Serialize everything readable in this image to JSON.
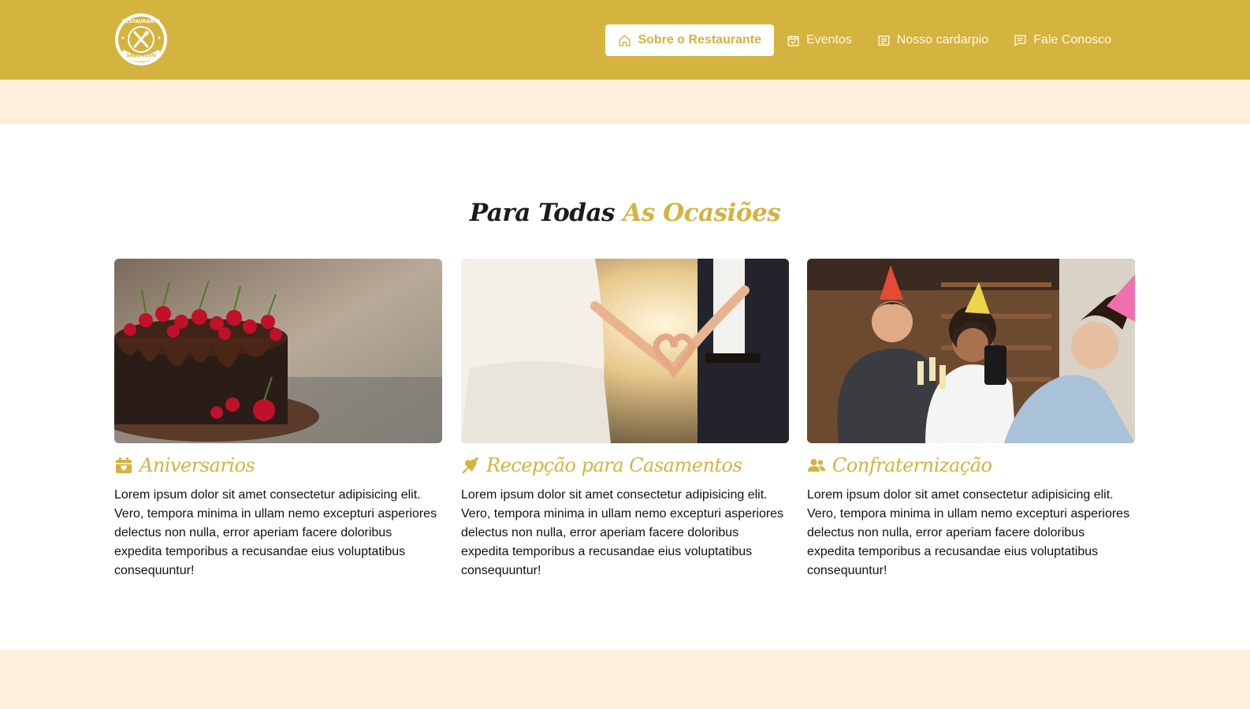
{
  "brand": {
    "logo_text_top": "RESTAURANTE",
    "logo_text_bottom": "SABOROSO"
  },
  "nav": {
    "items": [
      {
        "label": "Sobre o Restaurante",
        "icon": "home-icon"
      },
      {
        "label": "Eventos",
        "icon": "calendar-check-icon"
      },
      {
        "label": "Nosso cardarpio",
        "icon": "menu-list-icon"
      },
      {
        "label": "Fale Conosco",
        "icon": "message-icon"
      }
    ],
    "active_index": 0
  },
  "section": {
    "title_part1": "Para Todas",
    "title_part2": "As Ocasiões"
  },
  "cards": [
    {
      "title": "Aniversarios",
      "icon": "calendar-heart-icon",
      "image": "chocolate cake with cherries",
      "text": "Lorem ipsum dolor sit amet consectetur adipisicing elit. Vero, tempora minima in ullam nemo excepturi asperiores delectus non nulla, error aperiam facere doloribus expedita temporibus a recusandae eius voluptatibus consequuntur!"
    },
    {
      "title": "Recepção para Casamentos",
      "icon": "heart-arrow-icon",
      "image": "bride and groom forming heart with hands",
      "text": "Lorem ipsum dolor sit amet consectetur adipisicing elit. Vero, tempora minima in ullam nemo excepturi asperiores delectus non nulla, error aperiam facere doloribus expedita temporibus a recusandae eius voluptatibus consequuntur!"
    },
    {
      "title": "Confraternização",
      "icon": "users-icon",
      "image": "friends toasting at a party",
      "text": "Lorem ipsum dolor sit amet consectetur adipisicing elit. Vero, tempora minima in ullam nemo excepturi asperiores delectus non nulla, error aperiam facere doloribus expedita temporibus a recusandae eius voluptatibus consequuntur!"
    }
  ],
  "colors": {
    "primary": "#d4b33f",
    "band": "#feeedc",
    "text": "#111111"
  }
}
